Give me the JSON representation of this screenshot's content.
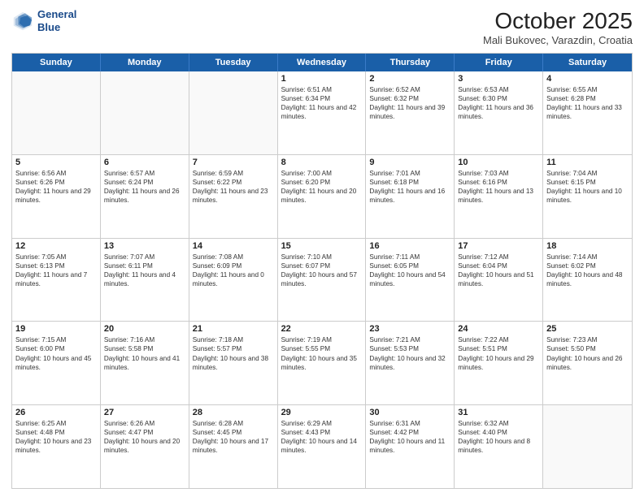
{
  "header": {
    "logo_line1": "General",
    "logo_line2": "Blue",
    "month_title": "October 2025",
    "location": "Mali Bukovec, Varazdin, Croatia"
  },
  "day_headers": [
    "Sunday",
    "Monday",
    "Tuesday",
    "Wednesday",
    "Thursday",
    "Friday",
    "Saturday"
  ],
  "weeks": [
    [
      {
        "day": "",
        "info": ""
      },
      {
        "day": "",
        "info": ""
      },
      {
        "day": "",
        "info": ""
      },
      {
        "day": "1",
        "info": "Sunrise: 6:51 AM\nSunset: 6:34 PM\nDaylight: 11 hours and 42 minutes."
      },
      {
        "day": "2",
        "info": "Sunrise: 6:52 AM\nSunset: 6:32 PM\nDaylight: 11 hours and 39 minutes."
      },
      {
        "day": "3",
        "info": "Sunrise: 6:53 AM\nSunset: 6:30 PM\nDaylight: 11 hours and 36 minutes."
      },
      {
        "day": "4",
        "info": "Sunrise: 6:55 AM\nSunset: 6:28 PM\nDaylight: 11 hours and 33 minutes."
      }
    ],
    [
      {
        "day": "5",
        "info": "Sunrise: 6:56 AM\nSunset: 6:26 PM\nDaylight: 11 hours and 29 minutes."
      },
      {
        "day": "6",
        "info": "Sunrise: 6:57 AM\nSunset: 6:24 PM\nDaylight: 11 hours and 26 minutes."
      },
      {
        "day": "7",
        "info": "Sunrise: 6:59 AM\nSunset: 6:22 PM\nDaylight: 11 hours and 23 minutes."
      },
      {
        "day": "8",
        "info": "Sunrise: 7:00 AM\nSunset: 6:20 PM\nDaylight: 11 hours and 20 minutes."
      },
      {
        "day": "9",
        "info": "Sunrise: 7:01 AM\nSunset: 6:18 PM\nDaylight: 11 hours and 16 minutes."
      },
      {
        "day": "10",
        "info": "Sunrise: 7:03 AM\nSunset: 6:16 PM\nDaylight: 11 hours and 13 minutes."
      },
      {
        "day": "11",
        "info": "Sunrise: 7:04 AM\nSunset: 6:15 PM\nDaylight: 11 hours and 10 minutes."
      }
    ],
    [
      {
        "day": "12",
        "info": "Sunrise: 7:05 AM\nSunset: 6:13 PM\nDaylight: 11 hours and 7 minutes."
      },
      {
        "day": "13",
        "info": "Sunrise: 7:07 AM\nSunset: 6:11 PM\nDaylight: 11 hours and 4 minutes."
      },
      {
        "day": "14",
        "info": "Sunrise: 7:08 AM\nSunset: 6:09 PM\nDaylight: 11 hours and 0 minutes."
      },
      {
        "day": "15",
        "info": "Sunrise: 7:10 AM\nSunset: 6:07 PM\nDaylight: 10 hours and 57 minutes."
      },
      {
        "day": "16",
        "info": "Sunrise: 7:11 AM\nSunset: 6:05 PM\nDaylight: 10 hours and 54 minutes."
      },
      {
        "day": "17",
        "info": "Sunrise: 7:12 AM\nSunset: 6:04 PM\nDaylight: 10 hours and 51 minutes."
      },
      {
        "day": "18",
        "info": "Sunrise: 7:14 AM\nSunset: 6:02 PM\nDaylight: 10 hours and 48 minutes."
      }
    ],
    [
      {
        "day": "19",
        "info": "Sunrise: 7:15 AM\nSunset: 6:00 PM\nDaylight: 10 hours and 45 minutes."
      },
      {
        "day": "20",
        "info": "Sunrise: 7:16 AM\nSunset: 5:58 PM\nDaylight: 10 hours and 41 minutes."
      },
      {
        "day": "21",
        "info": "Sunrise: 7:18 AM\nSunset: 5:57 PM\nDaylight: 10 hours and 38 minutes."
      },
      {
        "day": "22",
        "info": "Sunrise: 7:19 AM\nSunset: 5:55 PM\nDaylight: 10 hours and 35 minutes."
      },
      {
        "day": "23",
        "info": "Sunrise: 7:21 AM\nSunset: 5:53 PM\nDaylight: 10 hours and 32 minutes."
      },
      {
        "day": "24",
        "info": "Sunrise: 7:22 AM\nSunset: 5:51 PM\nDaylight: 10 hours and 29 minutes."
      },
      {
        "day": "25",
        "info": "Sunrise: 7:23 AM\nSunset: 5:50 PM\nDaylight: 10 hours and 26 minutes."
      }
    ],
    [
      {
        "day": "26",
        "info": "Sunrise: 6:25 AM\nSunset: 4:48 PM\nDaylight: 10 hours and 23 minutes."
      },
      {
        "day": "27",
        "info": "Sunrise: 6:26 AM\nSunset: 4:47 PM\nDaylight: 10 hours and 20 minutes."
      },
      {
        "day": "28",
        "info": "Sunrise: 6:28 AM\nSunset: 4:45 PM\nDaylight: 10 hours and 17 minutes."
      },
      {
        "day": "29",
        "info": "Sunrise: 6:29 AM\nSunset: 4:43 PM\nDaylight: 10 hours and 14 minutes."
      },
      {
        "day": "30",
        "info": "Sunrise: 6:31 AM\nSunset: 4:42 PM\nDaylight: 10 hours and 11 minutes."
      },
      {
        "day": "31",
        "info": "Sunrise: 6:32 AM\nSunset: 4:40 PM\nDaylight: 10 hours and 8 minutes."
      },
      {
        "day": "",
        "info": ""
      }
    ]
  ]
}
